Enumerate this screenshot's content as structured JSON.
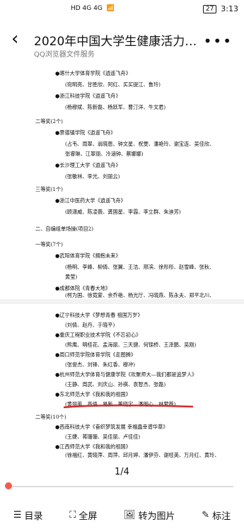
{
  "status": {
    "network": "HD 4G 4G",
    "time": "3:13",
    "battery": "27"
  },
  "header": {
    "title": "2020年中国大学生健康活力云…",
    "subtitle": "QQ浏览器文件服务",
    "back_icon": "chevron-left-icon",
    "more_icon": "more-icon"
  },
  "page1": [
    "●喀什大学体育学院《逍遥飞舟》",
    "(宛明亮、甘胜欣、阿红、买买提江、鲁玲)",
    "●浙江科技学院《逍遥飞舟》",
    "(杨穆斌、陈新磊、杨跃军、曹汀洋、牛文君)",
    "二等奖(2个)",
    "●景德镇学院《逍遥飞舟》",
    "(占韦、周翠、翁晓恩、钟文星、祝雯、潘艳玲、谢宝连、吴佳欣、",
    "张睿琳、江翠丽、冷涵钟、蔡娜娜)",
    "●长沙理工大学《逍遥飞舟》",
    "(张敏林、李光、刘丽云)",
    "三等奖(1个)",
    "●浙江中医药大学《逍遥飞舟》",
    "(顾潇威、陈凌薇、龚国星、李霞、李立群、朱迪芳)",
    "二、自编组单场操(项目2)",
    "一等奖(7个)",
    "●武阳体育学院《拥抱未来》",
    "(杨明、李峰、柳倩、张翼、王洁、邢滨、徐彤彤、赵雪峰、张秋、",
    "黄莹)",
    "●成都体院《青春大地》",
    "(柯为国、徐霓蒙、余乔艳、杨光厅、冯晓燕、陈永夫、郑平北川、",
    "马倩)"
  ],
  "page2": [
    "●辽宁科技大学《梦想青春 祖国万岁》",
    "(刘倩、赵丹、于晓平)",
    "●重庆工程职业技术学院《不忘初心》",
    "(熊鹰、明桂花、孟海丽、三天健、何锦桥、王泽鹏、吴刚)",
    "●周口师范学院体育学院《走图腾》",
    "(张俊杰、刘锋、朱红香、穆冲)",
    "●杭州师范大学体育与健康学院《欢聚师大—我们都是追梦人》",
    "(王静、周武、刘庆山、孙祺、袁智杰、张磊)",
    "●东北师范大学《我和我的祖国》",
    "(黄丽英、高倩、易新、董晓宇、潘明心、林萦薇)",
    "二等奖(10个)",
    "●西南科技大学《奋织梦筑发展 幸福鑫幸谱华章》",
    "(王婕、蒋珊珊、吴佳丽、卢佳佳)",
    "●江西师范大学《我和我的祖国》",
    "(徐福红、黄晓萍、周萍、邱月婷、潘伊芬、谢桂英、万月红、黄玲、",
    "…)"
  ],
  "pager": {
    "label": "1/4",
    "progress": 0.0
  },
  "toolbar": [
    {
      "label": "目录",
      "icon": "list-icon"
    },
    {
      "label": "全屏",
      "icon": "fullscreen-icon"
    },
    {
      "label": "转为图片",
      "icon": "image-convert-icon"
    },
    {
      "label": "标注",
      "icon": "annotate-icon"
    }
  ]
}
